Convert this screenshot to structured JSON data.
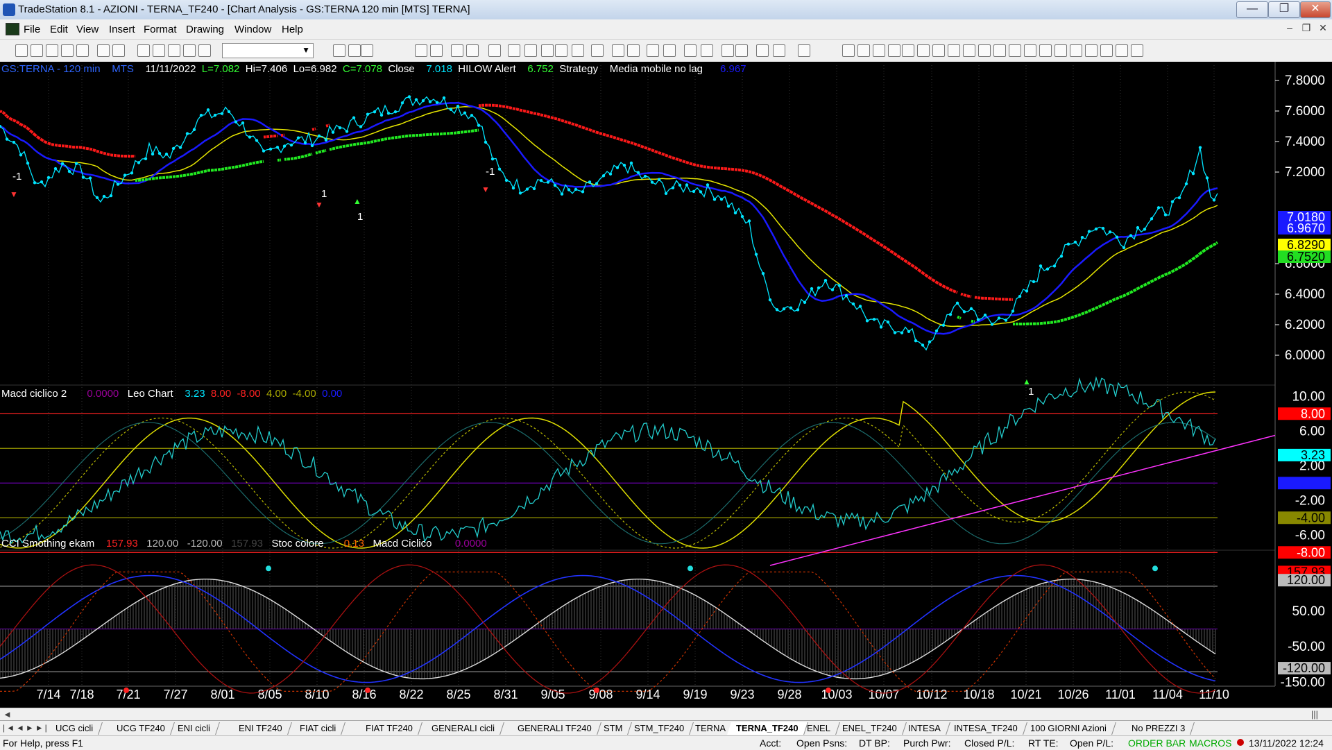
{
  "window": {
    "title": "TradeStation 8.1 - AZIONI - TERNA_TF240 - [Chart Analysis - GS:TERNA  120 min  [MTS] TERNA]",
    "minimize": "—",
    "restore": "❐",
    "close": "✕"
  },
  "menu": [
    "File",
    "Edit",
    "View",
    "Insert",
    "Format",
    "Drawing",
    "Window",
    "Help"
  ],
  "mdi_controls": [
    "–",
    "❐",
    "✕"
  ],
  "chart_header": {
    "symbol": "GS:TERNA - 120 min",
    "mts": "MTS",
    "date": "11/11/2022",
    "last": "L=7.082",
    "high": "Hi=7.406",
    "low": "Lo=6.982",
    "close_eq": "C=7.078",
    "close_label": "Close",
    "close_value": "7.018",
    "hilow_label": "HILOW Alert",
    "hilow_value": "6.752",
    "strategy": "Strategy",
    "media_label": "Media mobile no lag",
    "media_value": "6.967"
  },
  "macd_header": {
    "name": "Macd ciclico 2",
    "v1": "0.0000",
    "leo": "Leo Chart",
    "v2": "3.23",
    "v3": "8.00",
    "v4": "-8.00",
    "v5": "4.00",
    "v6": "-4.00",
    "v7": "0.00"
  },
  "cci_header": {
    "name": "CCI Smothing ekam",
    "v1": "157.93",
    "v2": "120.00",
    "v3": "-120.00",
    "v4": "157.93",
    "stoc": "Stoc colore",
    "v5": "0.13",
    "macd": "Macd Ciclico",
    "v6": "0.0000"
  },
  "price_axis": [
    "7.8000",
    "7.6000",
    "7.4000",
    "7.2000",
    "6.6000",
    "6.4000",
    "6.2000",
    "6.0000"
  ],
  "price_badges": [
    {
      "text": "7.0180",
      "bg": "#1a1aff",
      "fg": "#ffffff"
    },
    {
      "text": "6.9670",
      "bg": "#1a1aff",
      "fg": "#ffffff"
    },
    {
      "text": "6.8290",
      "bg": "#ffff00",
      "fg": "#000000"
    },
    {
      "text": "6.7520",
      "bg": "#22dd22",
      "fg": "#000000"
    }
  ],
  "macd_axis": [
    "10.00",
    "6.00",
    "2.00",
    "-2.00",
    "-6.00"
  ],
  "macd_badges": [
    {
      "text": "8.00",
      "bg": "#ff0000",
      "fg": "#ffffff"
    },
    {
      "text": "3.23",
      "bg": "#00ffff",
      "fg": "#000000"
    },
    {
      "text": "0.00",
      "bg": "#1a1aff",
      "fg": "#1a1aff"
    },
    {
      "text": "-4.00",
      "bg": "#888800",
      "fg": "#000000"
    },
    {
      "text": "-8.00",
      "bg": "#ff0000",
      "fg": "#ffffff"
    }
  ],
  "cci_axis": [
    "50.00",
    "-50.00",
    "-150.00"
  ],
  "cci_badges": [
    {
      "text": "157.93",
      "bg": "#ff0000",
      "fg": "#000000"
    },
    {
      "text": "120.00",
      "bg": "#bbbbbb",
      "fg": "#000000"
    },
    {
      "text": "-120.00",
      "bg": "#bbbbbb",
      "fg": "#000000"
    }
  ],
  "dates": [
    "7/14",
    "7/18",
    "7/21",
    "7/27",
    "8/01",
    "8/05",
    "8/10",
    "8/16",
    "8/22",
    "8/25",
    "8/31",
    "9/05",
    "9/08",
    "9/14",
    "9/19",
    "9/23",
    "9/28",
    "10/03",
    "10/07",
    "10/12",
    "10/18",
    "10/21",
    "10/26",
    "11/01",
    "11/04",
    "11/10"
  ],
  "signal_labels": [
    "-1",
    "1",
    "1",
    "-1",
    "1"
  ],
  "tabs": [
    "UCG cicli",
    "UCG TF240",
    "ENI cicli",
    "ENI TF240",
    "FIAT cicli",
    "FIAT TF240",
    "GENERALI cicli",
    "GENERALI TF240",
    "STM",
    "STM_TF240",
    "TERNA",
    "TERNA_TF240",
    "ENEL",
    "ENEL_TF240",
    "INTESA",
    "INTESA_TF240",
    "100 GIORNI Azioni",
    "No PREZZI 3"
  ],
  "status": {
    "help": "For Help, press F1",
    "acct": "Acct:",
    "open_psns": "Open Psns:",
    "dt_bp": "DT BP:",
    "purch_pwr": "Purch Pwr:",
    "closed_pl": "Closed P/L:",
    "rt_te": "RT TE:",
    "open_pl": "Open P/L:",
    "order_bar": "ORDER BAR",
    "macros": "MACROS",
    "datetime": "13/11/2022 12:24"
  },
  "colors": {
    "price": "#00e5ff",
    "ma_blue": "#1a1aff",
    "ma_yellow": "#e6e600",
    "hilow_red": "#ff1a1a",
    "hilow_green": "#22ee22",
    "trend": "#ff33ff"
  }
}
